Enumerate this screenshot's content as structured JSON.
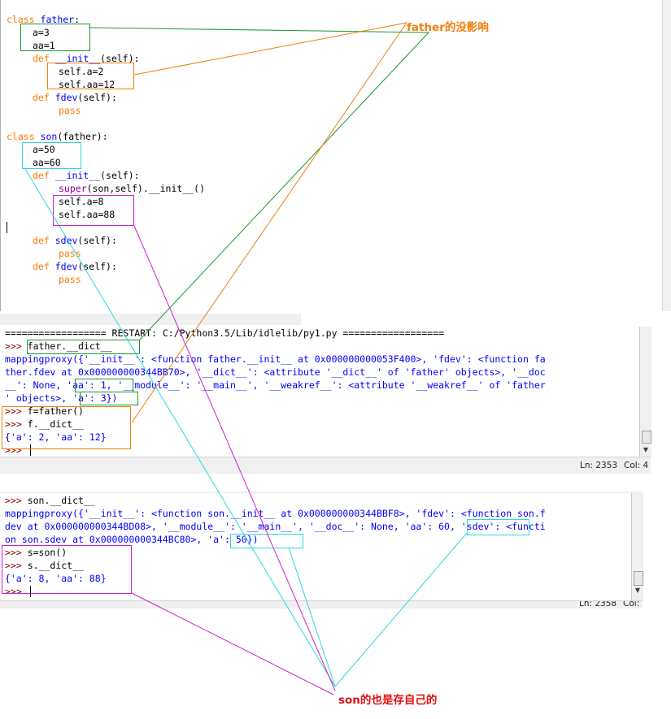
{
  "editor": {
    "l1": [
      "class",
      " ",
      "father",
      ":"
    ],
    "l2": "a=3",
    "l3": "aa=1",
    "l4": [
      "def",
      " ",
      "__init__",
      "(self):"
    ],
    "l5": "self.a=2",
    "l6": "self.aa=12",
    "l7": [
      "def",
      " ",
      "fdev",
      "(self):"
    ],
    "l8": "pass",
    "l10": [
      "class",
      " ",
      "son",
      "(father):"
    ],
    "l11": "a=50",
    "l12": "aa=60",
    "l13": [
      "def",
      " ",
      "__init__",
      "(self):"
    ],
    "l14": [
      "super",
      "(son,self).__init__()"
    ],
    "l15": "self.a=8",
    "l16": "self.aa=88",
    "l18": [
      "def",
      " ",
      "sdev",
      "(self):"
    ],
    "l19": "pass",
    "l20": [
      "def",
      " ",
      "fdev",
      "(self):"
    ],
    "l21": "pass"
  },
  "shell1": {
    "restart": "================== RESTART: C:/Python3.5/Lib/idlelib/py1.py ==================",
    "prompt": ">>>",
    "cmd1": " father.__dict__",
    "out1": "mappingproxy({'__init__': <function father.__init__ at 0x000000000053F400>, 'fdev': <function fa",
    "out2": "ther.fdev at 0x000000000344BB70>, '__dict__': <attribute '__dict__' of 'father' objects>, '__doc",
    "out3": "__': None, 'aa': 1, '__module__': '__main__', '__weakref__': <attribute '__weakref__' of 'father",
    "out4": "' objects>, 'a': 3})",
    "cmd2": " f=father()",
    "cmd3": " f.__dict__",
    "out5": "{'a': 2, 'aa': 12}",
    "status": {
      "ln": "Ln: 2353",
      "col": "Col: 4"
    }
  },
  "shell2": {
    "prompt": ">>>",
    "cmd1": " son.__dict__",
    "out1": "mappingproxy({'__init__': <function son.__init__ at 0x000000000344BBF8>, 'fdev': <function son.f",
    "out2": "dev at 0x000000000344BD08>, '__module__': '__main__', '__doc__': None, 'aa': 60, 'sdev': <functi",
    "out3": "on son.sdev at 0x000000000344BC80>, 'a': 50})",
    "cmd2": " s=son()",
    "cmd3": " s.__dict__",
    "out4": "{'a': 8, 'aa': 88}",
    "status": {
      "ln": "Ln: 2358",
      "col": "Col:"
    }
  },
  "annotations": {
    "father_note": "father的没影响",
    "son_note": "son的也是存自己的"
  },
  "colors": {
    "keyword": "#ff7700",
    "defname": "#0000ff",
    "builtin": "#900090",
    "prompt": "#8b0000",
    "output": "#0000ff",
    "ann_green": "#1a9a2a",
    "ann_orange": "#f07f0a",
    "ann_cyan": "#2fd6e0",
    "ann_magenta": "#d020d0",
    "note_orange": "#f07f0a",
    "note_red": "#e01010"
  },
  "icons": [
    "scroll-up-arrow-icon",
    "scroll-down-arrow-icon"
  ]
}
